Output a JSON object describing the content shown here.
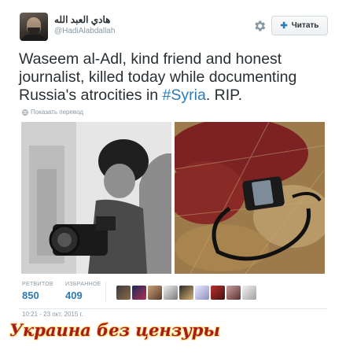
{
  "tweet": {
    "author": {
      "display_name": "هادي العبد الله",
      "screen_name": "@HadiAlabdallah",
      "avatar_icon": "avatar-photo"
    },
    "actions": {
      "settings_icon": "gear-icon",
      "follow_label": "Читать",
      "follow_icon": "add-user-icon"
    },
    "text_parts": {
      "before": "Waseem al-Adl, kind friend and honest journalist, killed today while documenting Russia's atrocities in ",
      "hashtag": "#Syria",
      "after": ". RIP."
    },
    "translate_label": "Показать перевод",
    "media": [
      {
        "alt": "photo-man-with-camera"
      },
      {
        "alt": "photo-camera-in-blood"
      }
    ],
    "stats": {
      "retweets_label": "РЕТВИТОВ",
      "retweets_value": "850",
      "likes_label": "ИЗБРАННОЕ",
      "likes_value": "409"
    },
    "timestamp": "10:21 - 23 окт. 2015 г."
  },
  "watermark": "Украина без цензуры",
  "colors": {
    "link": "#2b7bb9",
    "muted": "#8899a6",
    "text": "#292f33",
    "watermark": "#a51c1c"
  }
}
